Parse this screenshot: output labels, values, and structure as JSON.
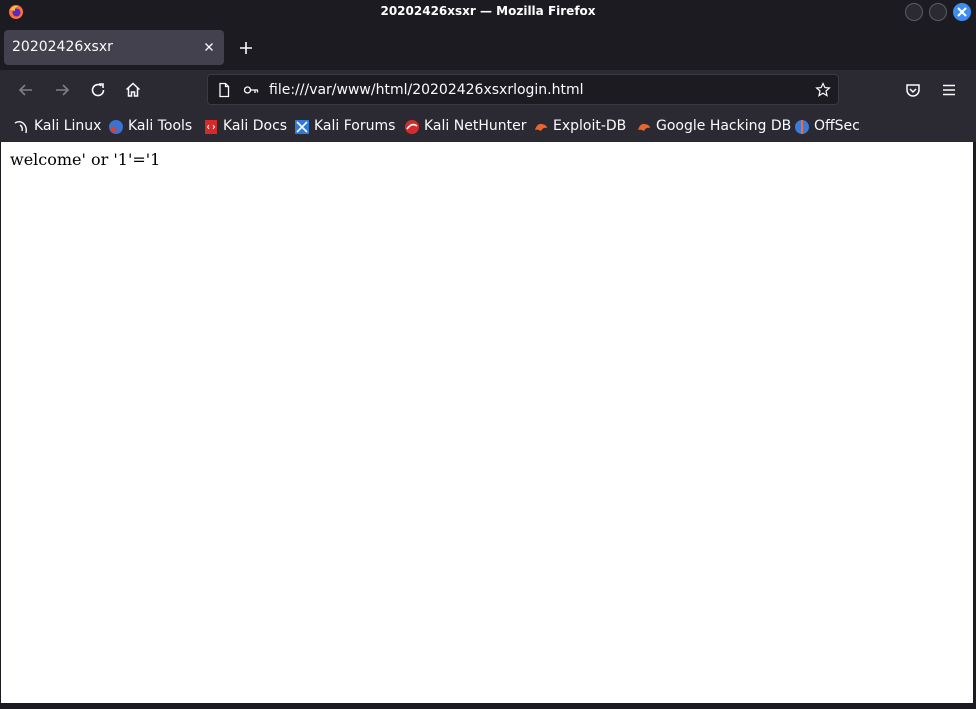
{
  "window": {
    "title": "20202426xsxr — Mozilla Firefox",
    "app_icon": "firefox-icon"
  },
  "tabs": [
    {
      "label": "20202426xsxr",
      "active": true
    }
  ],
  "toolbar": {
    "url": "file:///var/www/html/20202426xsxrlogin.html",
    "icons": [
      "back-icon",
      "forward-icon",
      "reload-icon",
      "home-icon",
      "page-icon",
      "key-icon",
      "bookmark-star-icon",
      "pocket-icon",
      "menu-icon"
    ]
  },
  "bookmarks": [
    {
      "label": "Kali Linux",
      "icon": "kali-dragon-icon"
    },
    {
      "label": "Kali Tools",
      "icon": "kali-tools-icon"
    },
    {
      "label": "Kali Docs",
      "icon": "kali-docs-icon"
    },
    {
      "label": "Kali Forums",
      "icon": "kali-forums-icon"
    },
    {
      "label": "Kali NetHunter",
      "icon": "nethunter-icon"
    },
    {
      "label": "Exploit-DB",
      "icon": "exploit-db-icon"
    },
    {
      "label": "Google Hacking DB",
      "icon": "ghdb-icon"
    },
    {
      "label": "OffSec",
      "icon": "offsec-icon"
    }
  ],
  "page": {
    "text": "welcome' or '1'='1"
  },
  "colors": {
    "chrome_dark": "#1c1b22",
    "toolbar": "#2b2a33",
    "tab_active": "#42414d",
    "close_button": "#3d8ef0"
  }
}
